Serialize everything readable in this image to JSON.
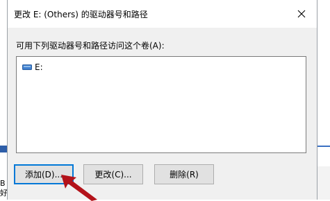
{
  "dialog": {
    "title": "更改 E: (Others) 的驱动器号和路径",
    "prompt": "可用下列驱动器号和路径访问这个卷(A):",
    "items": [
      {
        "label": "E:",
        "icon": "drive-icon"
      }
    ],
    "buttons": {
      "add": "添加(D)...",
      "change": "更改(C)...",
      "delete": "删除(R)"
    },
    "close_icon": "close-icon"
  },
  "background": {
    "left_text": [
      "B",
      "好"
    ]
  },
  "colors": {
    "accent": "#0078d7",
    "dialog_bg": "#f0f0f0",
    "arrow": "#b3121a",
    "drive_icon": "#3f7fd0"
  }
}
